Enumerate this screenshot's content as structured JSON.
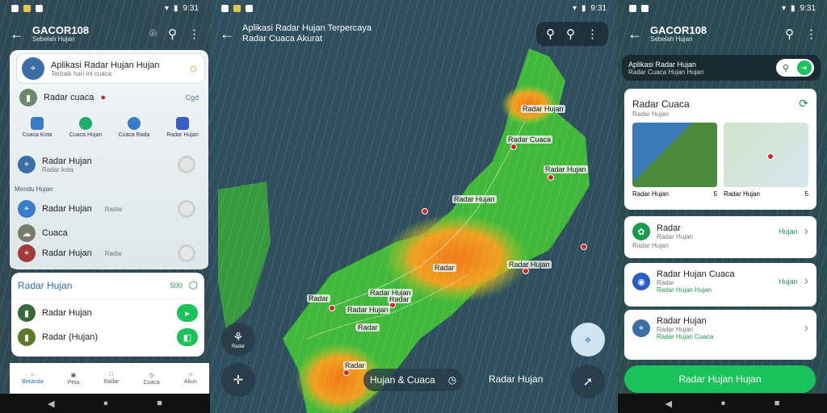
{
  "colors": {
    "accent_green": "#19c25a",
    "accent_blue": "#2a6fb0",
    "pin_red": "#d22222"
  },
  "p1": {
    "status_time": "9:31",
    "title": "GACOR108",
    "subtitle": "Sebelah Hujan",
    "search": {
      "title": "Aplikasi Radar Hujan Hujan",
      "sub": "Terbaik hari ini cuaca"
    },
    "radar_row": {
      "label": "Radar cuaca",
      "value": "Cgd"
    },
    "quick": [
      "Cuaca Kota",
      "Cuaca Hujan",
      "Cuaca Rada",
      "Radar Hujan"
    ],
    "items_top": [
      {
        "title": "Radar Hujan",
        "sub": "Radar kota"
      }
    ],
    "section_label": "Mendu Hujan",
    "items_mid": [
      {
        "title": "Radar Hujan",
        "extra": "Radar"
      },
      {
        "title": "Cuaca",
        "extra": ""
      },
      {
        "title": "Radar Hujan",
        "extra": "Radar"
      }
    ],
    "card": {
      "title": "Radar Hujan",
      "value": "500",
      "rows": [
        {
          "title": "Radar Hujan"
        },
        {
          "title": "Radar (Hujan)"
        }
      ]
    },
    "tabs": [
      "Beranda",
      "Peta",
      "Radar",
      "Cuaca",
      "Akun"
    ]
  },
  "p2": {
    "status_time": "9:31",
    "title": "Aplikasi Radar Hujan Terpercaya",
    "subtitle": "Radar Cuaca Akurat",
    "labels": [
      "Radar Hujan",
      "Radar Cuaca",
      "Radar Hujan",
      "Radar Hujan",
      "Radar",
      "Radar Hujan",
      "Radar",
      "Radar Hujan",
      "Radar",
      "Radar Hujan",
      "Radar",
      "Radar"
    ],
    "fab_left_top": "Radar",
    "chip": "Hujan & Cuaca",
    "footer_text": "Radar Hujan"
  },
  "p3": {
    "status_time": "9:31",
    "title": "GACOR108",
    "subtitle": "Sebelah Hujan",
    "banner": {
      "title": "Aplikasi Radar Hujan",
      "sub": "Radar Cuaca Hujan Hujan"
    },
    "card": {
      "title": "Radar Cuaca",
      "sub": "Radar Hujan",
      "thumbs": [
        {
          "label": "Radar Hujan",
          "value": "5"
        },
        {
          "label": "Radar Hujan",
          "value": "5"
        }
      ]
    },
    "list": [
      {
        "title": "Radar",
        "sub": "Radar Hujan",
        "extra": "Radar Hujan",
        "action": "Hujan"
      },
      {
        "title": "Radar Hujan Cuaca",
        "sub": "Radar",
        "extra": "Radar Hujan Hujan",
        "action": "Hujan"
      },
      {
        "title": "Radar Hujan",
        "sub": "Radar Hujan",
        "extra": "Radar Hujan Cuaca",
        "action": ""
      }
    ],
    "cta": "Radar Hujan Hujan"
  }
}
